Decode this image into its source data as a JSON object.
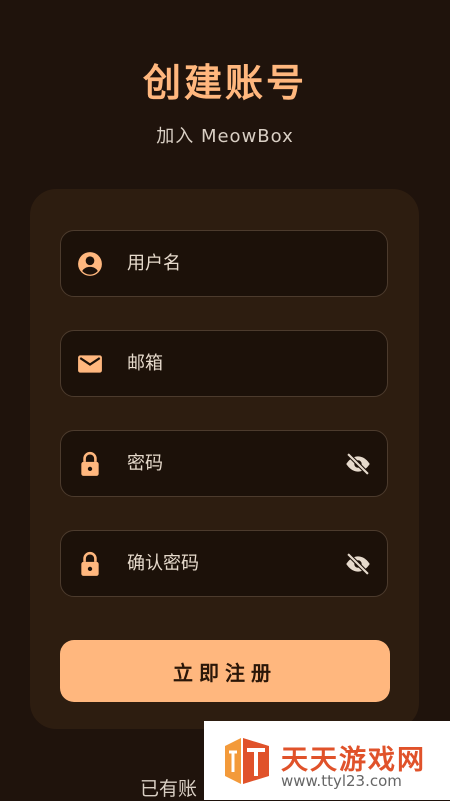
{
  "header": {
    "title": "创建账号",
    "subtitle": "加入 MeowBox"
  },
  "form": {
    "username": {
      "placeholder": "用户名",
      "icon": "account-circle-icon"
    },
    "email": {
      "placeholder": "邮箱",
      "icon": "mail-icon"
    },
    "password": {
      "placeholder": "密码",
      "icon": "lock-icon",
      "toggle_icon": "eye-off-icon"
    },
    "confirm_password": {
      "placeholder": "确认密码",
      "icon": "lock-icon",
      "toggle_icon": "eye-off-icon"
    },
    "submit_label": "立即注册"
  },
  "footer": {
    "login_prompt": "已有账"
  },
  "watermark": {
    "name": "天天游戏网",
    "url": "www.ttyl23.com"
  },
  "colors": {
    "background": "#1f130c",
    "card": "#2d1d10",
    "accent": "#ffb77e",
    "field_bg": "#1c1109",
    "field_border": "#4c3b2d"
  }
}
